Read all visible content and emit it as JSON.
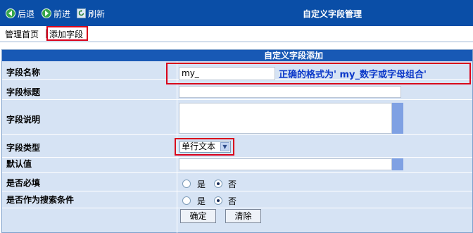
{
  "toolbar": {
    "back_label": "后退",
    "forward_label": "前进",
    "refresh_label": "刷新",
    "title": "自定义字段管理"
  },
  "breadcrumb": {
    "home": "管理首页",
    "separator": "|",
    "current": "添加字段"
  },
  "form": {
    "header": "自定义字段添加",
    "fields": {
      "name": {
        "label": "字段名称",
        "value": "my_",
        "hint": "正确的格式为' my_数字或字母组合'"
      },
      "title": {
        "label": "字段标题",
        "value": ""
      },
      "description": {
        "label": "字段说明",
        "value": ""
      },
      "type": {
        "label": "字段类型",
        "selected": "单行文本"
      },
      "default": {
        "label": "默认值",
        "value": ""
      },
      "required": {
        "label": "是否必填",
        "yes": "是",
        "no": "否",
        "selected": "否"
      },
      "searchable": {
        "label": "是否作为搜索条件",
        "yes": "是",
        "no": "否",
        "selected": "否"
      }
    },
    "buttons": {
      "submit": "确定",
      "reset": "清除"
    }
  },
  "colors": {
    "toolbar_bg": "#0a4ea7",
    "panel_bg": "#d6e3f4",
    "panel_header_bg": "#1859b5",
    "highlight": "#d9001b",
    "hint_text": "#0b38c9"
  }
}
